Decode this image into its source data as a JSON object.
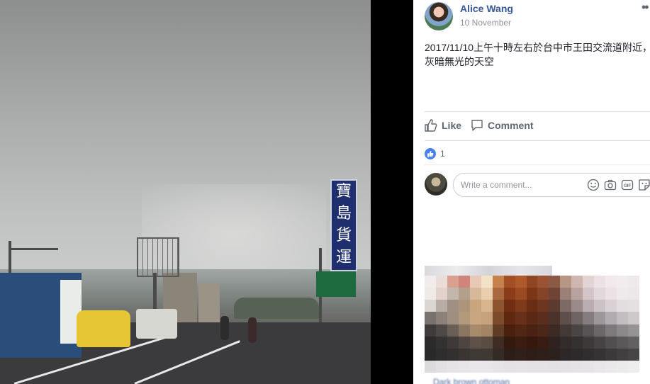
{
  "post": {
    "author": "Alice Wang",
    "date": "10 November",
    "more_icon": "more-dots-icon",
    "text": "2017/11/10上午十時左右於台中市王田交流道附近，\n灰暗無光的天空",
    "actions": {
      "like": "Like",
      "comment": "Comment"
    },
    "like_count": "1",
    "comment_placeholder": "Write a comment..."
  },
  "photo": {
    "sign_chars": [
      "寶",
      "島",
      "貨",
      "運"
    ]
  },
  "suggestion": {
    "caption": "Dark brown ottoman"
  },
  "colors": {
    "link_blue": "#365899",
    "like_blue": "#4a7ff0",
    "muted_text": "#90949c",
    "border": "#dddfe2"
  },
  "mosaic_colors": [
    "#f1eceb",
    "#e9dcd9",
    "#d9a092",
    "#d0857a",
    "#e8c9b8",
    "#f2e2c7",
    "#c7814c",
    "#a34f25",
    "#b05a2c",
    "#8f4424",
    "#9b5333",
    "#8a5a44",
    "#b79686",
    "#cdb7ae",
    "#e2d4d5",
    "#ece2e5",
    "#f2e9ea",
    "#f1edee",
    "#eeeaea",
    "#efe9e8",
    "#e3d2cc",
    "#c2b6ad",
    "#b3a08c",
    "#d7b89a",
    "#e9cfae",
    "#a9683f",
    "#8c3b18",
    "#9b4a21",
    "#7c3517",
    "#844428",
    "#6f4335",
    "#9b8077",
    "#b8a3a0",
    "#d4c6c8",
    "#e2d7db",
    "#ebe2e5",
    "#eee9ea",
    "#ece8e8",
    "#dcd6d3",
    "#b8ada5",
    "#a08f83",
    "#ad957b",
    "#caa47d",
    "#d7b48d",
    "#8c5530",
    "#712d12",
    "#7e3a19",
    "#6b2d13",
    "#6c3620",
    "#5c3a2f",
    "#7e6a64",
    "#9a8b8a",
    "#b9adb1",
    "#cbc2c7",
    "#d9d1d5",
    "#e3dde0",
    "#e4e0e0",
    "#7a726e",
    "#8b817a",
    "#9f8f81",
    "#b39a7d",
    "#c8a67f",
    "#c6a17c",
    "#7d4a2a",
    "#5f2610",
    "#66301a",
    "#5a2815",
    "#5a2e1e",
    "#4b322a",
    "#5d4f4b",
    "#6e6463",
    "#857c80",
    "#9d969b",
    "#b2acb0",
    "#c2bdc0",
    "#cdc9ca",
    "#3e3b3a",
    "#4e4946",
    "#6a5f57",
    "#8a7663",
    "#a78b6b",
    "#a38566",
    "#603c25",
    "#4a1f0e",
    "#522615",
    "#4a2112",
    "#4a2719",
    "#3c2a24",
    "#433a38",
    "#4b4444",
    "#5a5356",
    "#6c666a",
    "#7e797c",
    "#8d898b",
    "#969394",
    "#2b2a2a",
    "#343131",
    "#3f3a38",
    "#4e4540",
    "#5e5148",
    "#5b4c41",
    "#3f2c22",
    "#34190f",
    "#3b1d12",
    "#37180f",
    "#391d15",
    "#302220",
    "#332c2b",
    "#363131",
    "#3d393a",
    "#474345",
    "#514e4f",
    "#5b5859",
    "#636061",
    "#2a2929",
    "#2f2d2d",
    "#333030",
    "#3a3533",
    "#403a37",
    "#3f3834",
    "#342a26",
    "#2d1d18",
    "#301f1a",
    "#2e1c17",
    "#2f1f1a",
    "#2b2220",
    "#2d2827",
    "#2e2a2a",
    "#312e2e",
    "#363333",
    "#3b3939",
    "#413f3f",
    "#464444",
    "#dcdadc",
    "#e2e0e2",
    "#e5e3e5",
    "#e7e5e7",
    "#e9e7e9",
    "#e8e6e8",
    "#e6e4e6",
    "#e4e2e4",
    "#e5e3e5",
    "#e4e2e4",
    "#e4e2e4",
    "#e3e1e3",
    "#e4e2e4",
    "#e5e3e5",
    "#e6e4e6",
    "#e8e6e8",
    "#eae8ea",
    "#ecebec",
    "#eeedee"
  ]
}
